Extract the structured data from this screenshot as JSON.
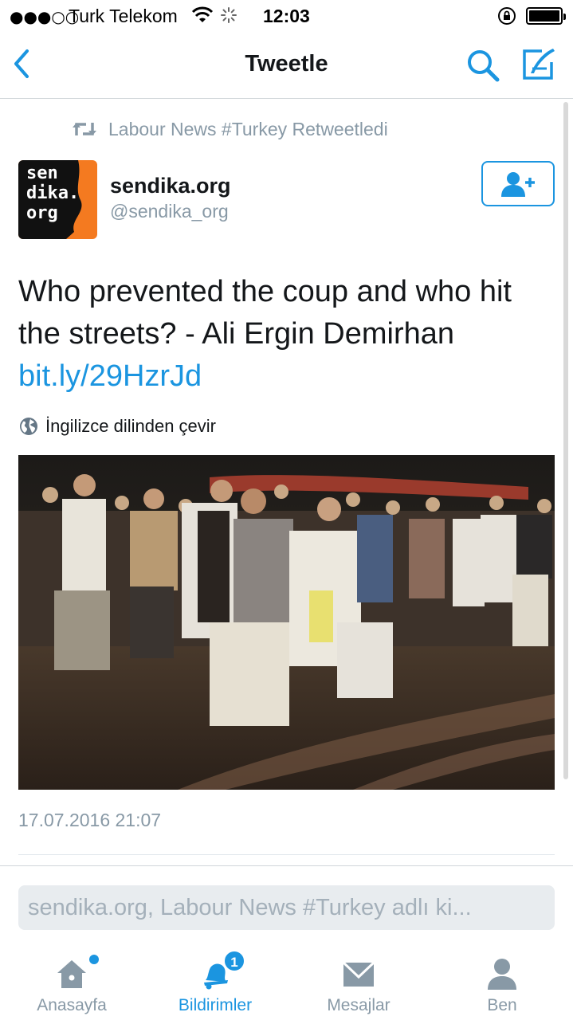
{
  "status_bar": {
    "signal": "●●●○○",
    "carrier": "Turk Telekom",
    "time": "12:03"
  },
  "nav": {
    "title": "Tweetle"
  },
  "retweet": {
    "text": "Labour News #Turkey Retweetledi"
  },
  "author": {
    "avatar_lines": [
      "sen",
      "dika.",
      "org"
    ],
    "name": "sendika.org",
    "handle": "@sendika_org"
  },
  "tweet": {
    "text": "Who prevented the coup and who hit the streets? - Ali Ergin Demirhan ",
    "link": "bit.ly/29HzrJd",
    "translate_label": "İngilizce dilinden çevir",
    "timestamp": "17.07.2016 21:07"
  },
  "reply": {
    "placeholder": "sendika.org, Labour News #Turkey adlı ki..."
  },
  "tabs": [
    {
      "label": "Anasayfa",
      "icon": "home-icon",
      "active": false
    },
    {
      "label": "Bildirimler",
      "icon": "bell-icon",
      "active": true,
      "badge": "1"
    },
    {
      "label": "Mesajlar",
      "icon": "mail-icon",
      "active": false
    },
    {
      "label": "Ben",
      "icon": "person-icon",
      "active": false
    }
  ],
  "colors": {
    "accent": "#1b95e0",
    "muted": "#8899a6",
    "avatar_bg": "#f47a20"
  }
}
